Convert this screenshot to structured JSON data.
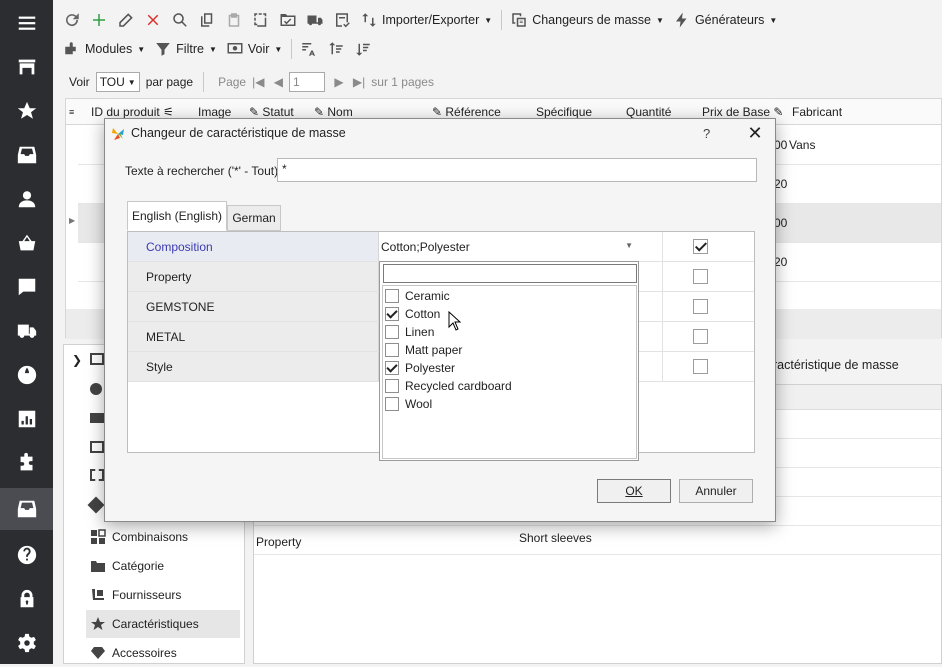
{
  "toolbar1": {
    "import_export": "Importer/Exporter",
    "bulk_changers": "Changeurs de masse",
    "generators": "Générateurs"
  },
  "toolbar2": {
    "modules": "Modules",
    "filter": "Filtre",
    "view": "Voir"
  },
  "pager": {
    "show_label": "Voir",
    "per_page_value": "TOU",
    "per_page_label": "par page",
    "page_label": "Page",
    "page_value": "1",
    "of_pages": "sur 1 pages"
  },
  "grid": {
    "columns": [
      "ID du produit",
      "Image",
      "Statut",
      "Nom",
      "Référence",
      "Spécifique",
      "Quantité",
      "Prix de Base",
      "Fabricant"
    ],
    "rows": [
      {
        "price_tail": "00",
        "manufacturer": "Vans"
      },
      {
        "price_tail": "20",
        "manufacturer": ""
      },
      {
        "price_tail": "00",
        "manufacturer": ""
      },
      {
        "price_tail": "20",
        "manufacturer": ""
      }
    ]
  },
  "side_panel": {
    "items": [
      {
        "label": "Combinaisons",
        "icon": "combinations-icon"
      },
      {
        "label": "Catégorie",
        "icon": "category-icon"
      },
      {
        "label": "Fournisseurs",
        "icon": "suppliers-icon"
      },
      {
        "label": "Caractéristiques",
        "icon": "star-icon"
      },
      {
        "label": "Accessoires",
        "icon": "diamond-icon"
      }
    ]
  },
  "detail": {
    "title_fragment": "ractéristique de masse",
    "row_label": "Property",
    "row_value": "Short sleeves"
  },
  "dialog": {
    "title": "Changeur de caractéristique de masse",
    "help": "?",
    "close": "✕",
    "search_label": "Texte à rechercher ('*' - Tout)",
    "search_value": "*",
    "tabs": [
      "English (English)",
      "German"
    ],
    "properties": [
      {
        "name": "Composition",
        "value": "Cotton;Polyester",
        "checked": true
      },
      {
        "name": "Property",
        "value": "",
        "checked": false
      },
      {
        "name": "GEMSTONE",
        "value": "",
        "checked": false
      },
      {
        "name": "METAL",
        "value": "",
        "checked": false
      },
      {
        "name": "Style",
        "value": "",
        "checked": false
      }
    ],
    "options": [
      {
        "label": "Ceramic",
        "checked": false
      },
      {
        "label": "Cotton",
        "checked": true
      },
      {
        "label": "Linen",
        "checked": false
      },
      {
        "label": "Matt paper",
        "checked": false
      },
      {
        "label": "Polyester",
        "checked": true
      },
      {
        "label": "Recycled cardboard",
        "checked": false
      },
      {
        "label": "Wool",
        "checked": false
      }
    ],
    "ok_label": "OK",
    "cancel_label": "Annuler"
  }
}
